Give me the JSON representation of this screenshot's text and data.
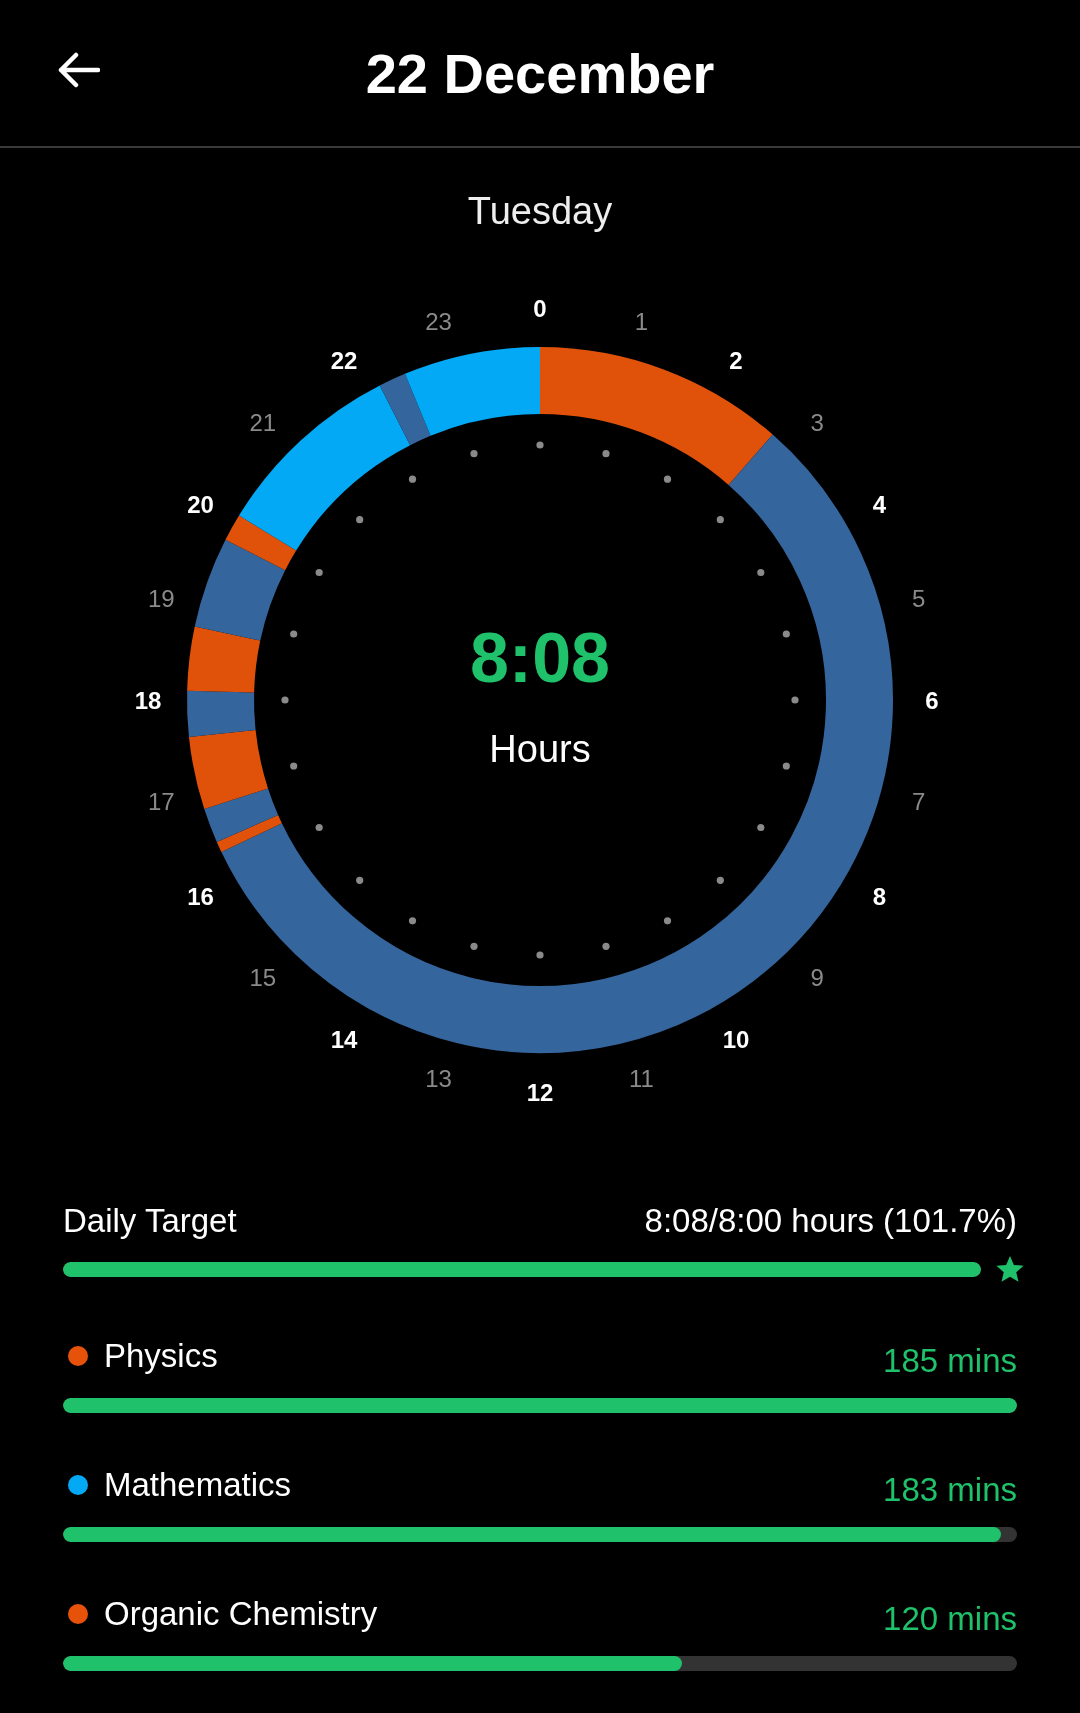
{
  "header": {
    "title": "22 December"
  },
  "day": "Tuesday",
  "dial": {
    "hour_labels": [
      "0",
      "1",
      "2",
      "3",
      "4",
      "5",
      "6",
      "7",
      "8",
      "9",
      "10",
      "11",
      "12",
      "13",
      "14",
      "15",
      "16",
      "17",
      "18",
      "19",
      "20",
      "21",
      "22",
      "23"
    ],
    "total": "8:08",
    "unit": "Hours"
  },
  "daily_target": {
    "label": "Daily Target",
    "reading": "8:08/8:00 hours (101.7%)",
    "level": 1,
    "achieved": true
  },
  "subjects": [
    {
      "name": "Physics",
      "color": "#e6520a",
      "minutes": "185 mins",
      "level": 1
    },
    {
      "name": "Mathematics",
      "color": "#03a9f4",
      "minutes": "183 mins",
      "level": 0.983
    },
    {
      "name": "Organic Chemistry",
      "color": "#e6520a",
      "minutes": "120 mins",
      "level": 0.649
    }
  ]
}
